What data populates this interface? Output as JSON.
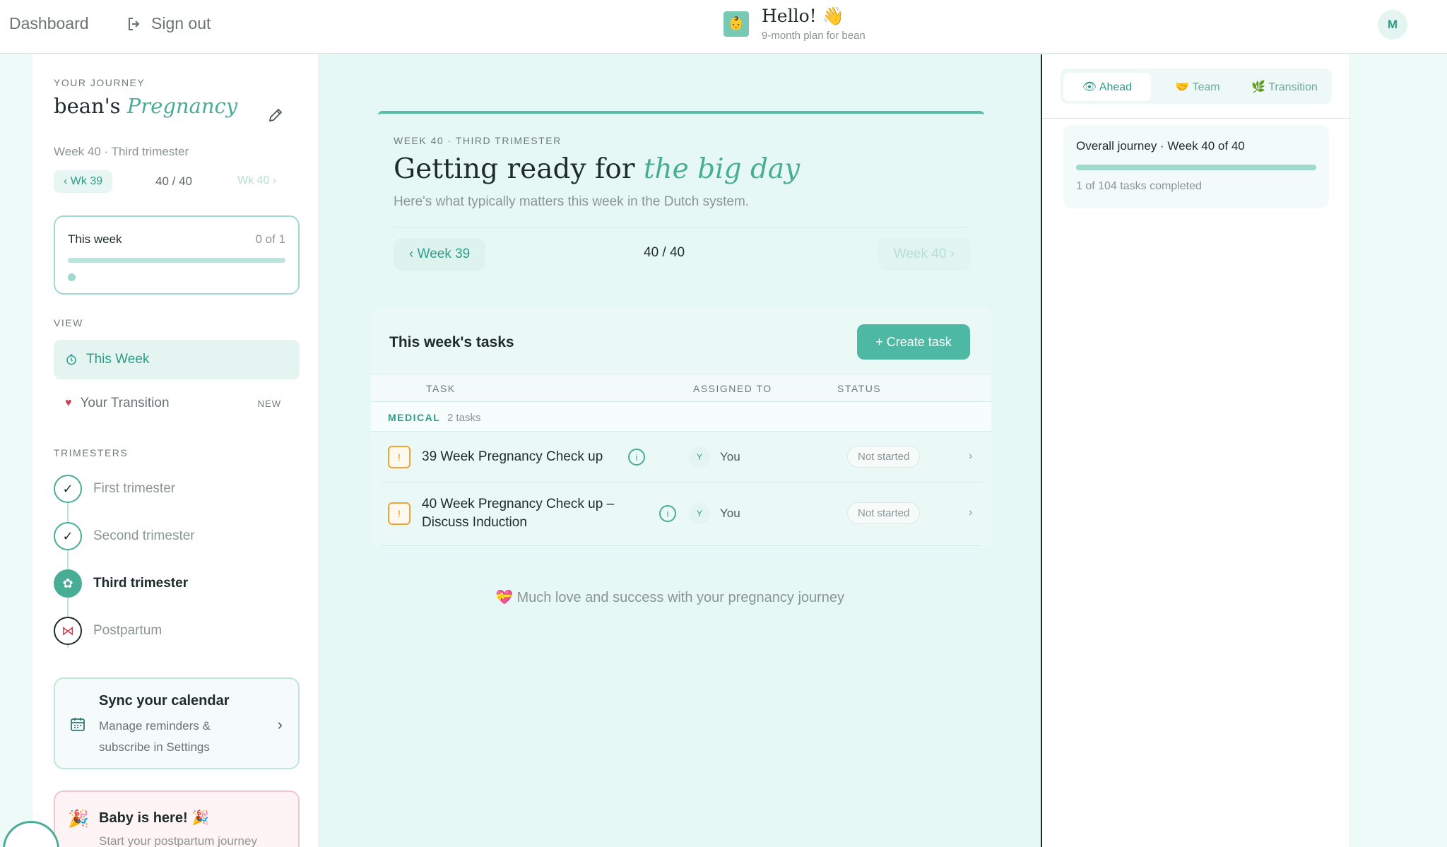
{
  "topbar": {
    "dashboard": "Dashboard",
    "sign_out": "Sign out",
    "hello": "Hello! 👋",
    "plan": "9-month plan for bean",
    "avatar": "M"
  },
  "sidebar": {
    "journey_label": "YOUR JOURNEY",
    "journey_name": "bean's",
    "journey_type": "Pregnancy",
    "journey_sub": "Week 40 · Third trimester",
    "prev_week": "‹ Wk 39",
    "week_count": "40 / 40",
    "next_week": "Wk 40 ›",
    "this_week": {
      "title": "This week",
      "count": "0 of 1",
      "progress": 0
    },
    "view_label": "VIEW",
    "views": [
      {
        "label": "This Week",
        "icon": "clock-icon",
        "active": true
      },
      {
        "label": "Your Transition",
        "icon": "heart-icon",
        "badge": "NEW"
      }
    ],
    "trimesters_label": "TRIMESTERS",
    "trimesters": [
      {
        "label": "First trimester",
        "state": "done"
      },
      {
        "label": "Second trimester",
        "state": "done"
      },
      {
        "label": "Third trimester",
        "state": "current"
      },
      {
        "label": "Postpartum",
        "state": "upcoming"
      }
    ],
    "sync": {
      "title": "Sync your calendar",
      "desc": "Manage reminders & subscribe in Settings"
    },
    "baby": {
      "title": "Baby is here! 🎉",
      "desc": "Start your postpartum journey"
    }
  },
  "hero": {
    "kicker": "WEEK 40 · THIRD TRIMESTER",
    "title_plain": "Getting ready for",
    "title_em": "the big day",
    "subtitle": "Here's what typically matters this week in the Dutch system.",
    "prev": "‹ Week 39",
    "count": "40 / 40",
    "next": "Week 40 ›"
  },
  "tasks": {
    "title": "This week's tasks",
    "create": "+ Create task",
    "headers": {
      "task": "TASK",
      "assigned": "ASSIGNED TO",
      "status": "STATUS"
    },
    "group": {
      "name": "MEDICAL",
      "count": "2 tasks"
    },
    "rows": [
      {
        "priority": "!",
        "name": "39 Week Pregnancy Check up",
        "assignee_initial": "Y",
        "assignee": "You",
        "status": "Not started"
      },
      {
        "priority": "!",
        "name": "40 Week Pregnancy Check up – Discuss Induction",
        "assignee_initial": "Y",
        "assignee": "You",
        "status": "Not started"
      }
    ],
    "footer": "💝 Much love and success with your pregnancy journey"
  },
  "rightpanel": {
    "tabs": [
      {
        "label": "👁 Ahead",
        "active": true
      },
      {
        "label": "🤝 Team"
      },
      {
        "label": "🌿 Transition"
      }
    ],
    "overall": {
      "title": "Overall journey · Week 40 of 40",
      "sub": "1 of 104 tasks completed",
      "progress": 1.0
    }
  },
  "colors": {
    "accent": "#48ad95",
    "button": "#4db9a2",
    "priority": "#f0a33a"
  }
}
